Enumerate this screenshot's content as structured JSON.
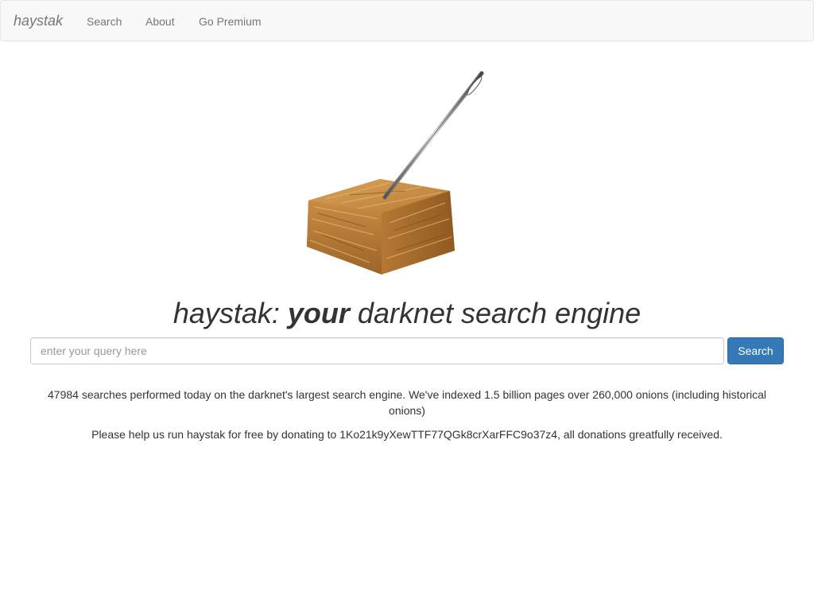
{
  "navbar": {
    "brand": "haystak",
    "links": [
      {
        "label": "Search"
      },
      {
        "label": "About"
      },
      {
        "label": "Go Premium"
      }
    ]
  },
  "hero": {
    "image_icon": "needle-in-haystack-icon"
  },
  "headline": {
    "prefix": "haystak: ",
    "emphasis": "your",
    "suffix": " darknet search engine"
  },
  "search": {
    "placeholder": "enter your query here",
    "value": "",
    "button_label": "Search"
  },
  "stats": {
    "text": "47984 searches performed today on the darknet's largest search engine. We've indexed 1.5 billion pages over 260,000 onions (including historical onions)"
  },
  "donate": {
    "text": "Please help us run haystak for free by donating to 1Ko21k9yXewTTF77QGk8crXarFFC9o37z4, all donations greatfully received."
  },
  "colors": {
    "navbar_bg": "#f8f8f8",
    "button_bg": "#337ab7",
    "text": "#333333",
    "muted": "#777777"
  }
}
